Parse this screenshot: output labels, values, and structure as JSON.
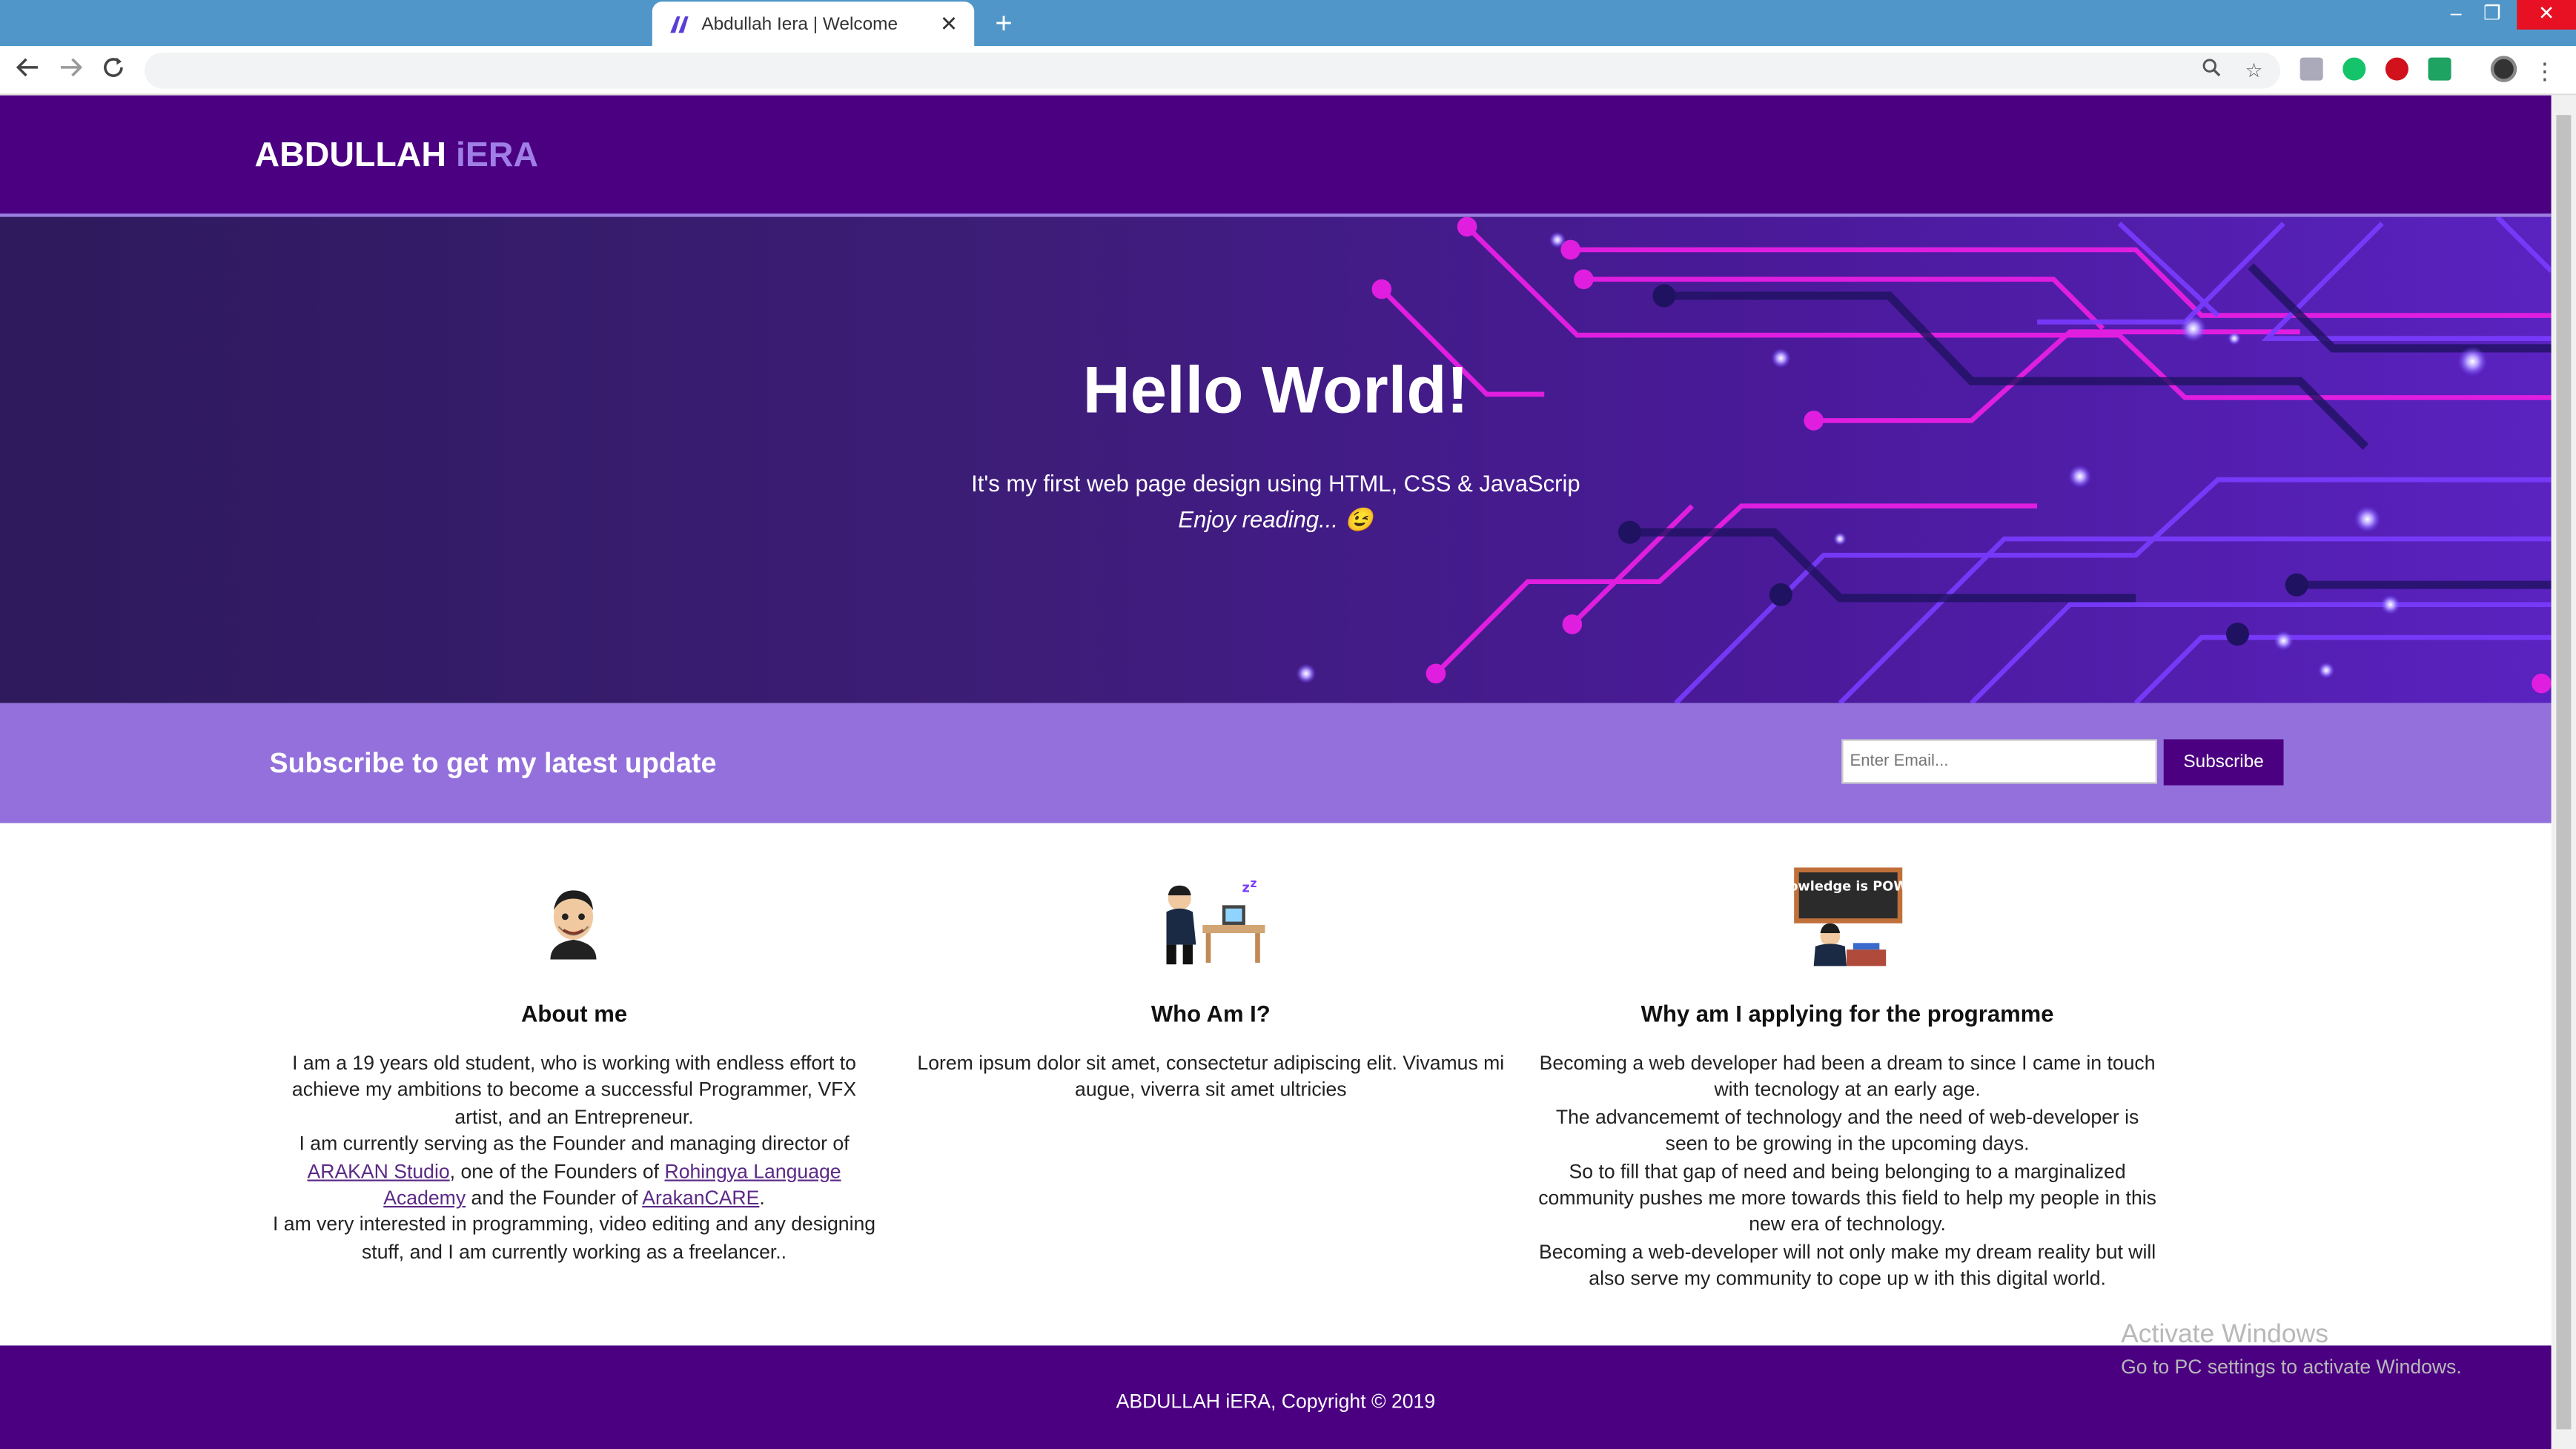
{
  "browser": {
    "tab_title": "Abdullah Iera | Welcome",
    "new_tab": "+",
    "close": "✕",
    "address": ""
  },
  "site": {
    "logo_main": "ABDULLAH ",
    "logo_accent": "iERA"
  },
  "hero": {
    "title": "Hello World!",
    "subtitle": "It's my first web page design using HTML, CSS & JavaScrip",
    "tagline": "Enjoy reading... 😉"
  },
  "subscribe": {
    "heading": "Subscribe to get my latest update",
    "placeholder": "Enter Email...",
    "button": "Subscribe"
  },
  "columns": {
    "about": {
      "title": "About me",
      "p1": "I am a 19 years old student, who is working with endless effort to achieve my ambitions to become a successful Programmer, VFX artist, and an Entrepreneur.",
      "p2_a": "I am currently serving as the Founder and managing director of ",
      "link1": "ARAKAN Studio",
      "p2_b": ", one of the Founders of ",
      "link2": "Rohingya Language Academy",
      "p2_c": " and the Founder of ",
      "link3": "ArakanCARE",
      "p2_d": ".",
      "p3": "I am very interested in programming, video editing and any designing stuff, and I am currently working as a freelancer.."
    },
    "who": {
      "title": "Who Am I?",
      "p1": "Lorem ipsum dolor sit amet, consectetur adipiscing elit. Vivamus mi augue, viverra sit amet ultricies"
    },
    "why": {
      "title": "Why am I applying for the programme",
      "board_text": "Knowledge is POWER",
      "p1": "Becoming a web developer had been a dream to since I came in touch with tecnology at an early age.",
      "p2": "The advancememt of technology and the need of web-developer is seen to be growing in the upcoming days.",
      "p3": "So to fill that gap of need and being belonging to a marginalized community pushes me more towards this field to help my people in this new era of technology.",
      "p4": "Becoming a web-developer will not only make my dream reality but will also serve my community to cope up w ith this digital world."
    }
  },
  "footer": {
    "text": "ABDULLAH iERA, Copyright © 2019"
  },
  "watermark": {
    "line1": "Activate Windows",
    "line2": "Go to PC settings to activate Windows."
  },
  "colors": {
    "header": "#4b0082",
    "accent": "#9370db"
  }
}
